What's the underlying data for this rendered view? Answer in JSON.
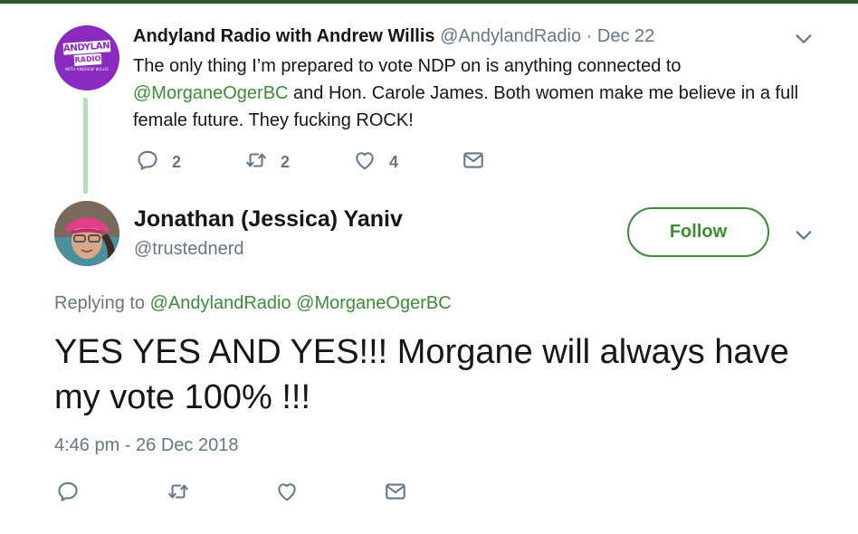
{
  "parent_tweet": {
    "avatar_logo": {
      "line1": "ANDYLAND",
      "line2": "RADIO",
      "line3": "WITH ANDREW WILLIS"
    },
    "display_name": "Andyland Radio with Andrew Willis",
    "handle": "@AndylandRadio",
    "separator": "·",
    "date": "Dec 22",
    "body_part1": "The only thing I’m prepared to vote NDP on is anything connected to ",
    "body_mention": "@MorganeOgerBC",
    "body_part2": " and Hon. Carole James. Both women make me believe in a full female future. They fucking ROCK!",
    "reply_count": "2",
    "retweet_count": "2",
    "like_count": "4"
  },
  "main_tweet": {
    "display_name": "Jonathan (Jessica) Yaniv",
    "handle": "@trustednerd",
    "follow_label": "Follow",
    "replying_prefix": "Replying to",
    "replying_mention1": "@AndylandRadio",
    "replying_mention2": "@MorganeOgerBC",
    "body": "YES YES AND YES!!! Morgane will always have my vote 100% !!!",
    "timestamp": "4:46 pm - 26 Dec 2018"
  },
  "colors": {
    "accent_green": "#3d8b37",
    "muted_gray": "#657786",
    "thread_line": "#b9dbb5",
    "avatar_purple": "#8a2bbf"
  },
  "icons": {
    "reply": "reply-icon",
    "retweet": "retweet-icon",
    "like": "heart-icon",
    "message": "envelope-icon",
    "more": "chevron-down-icon"
  }
}
